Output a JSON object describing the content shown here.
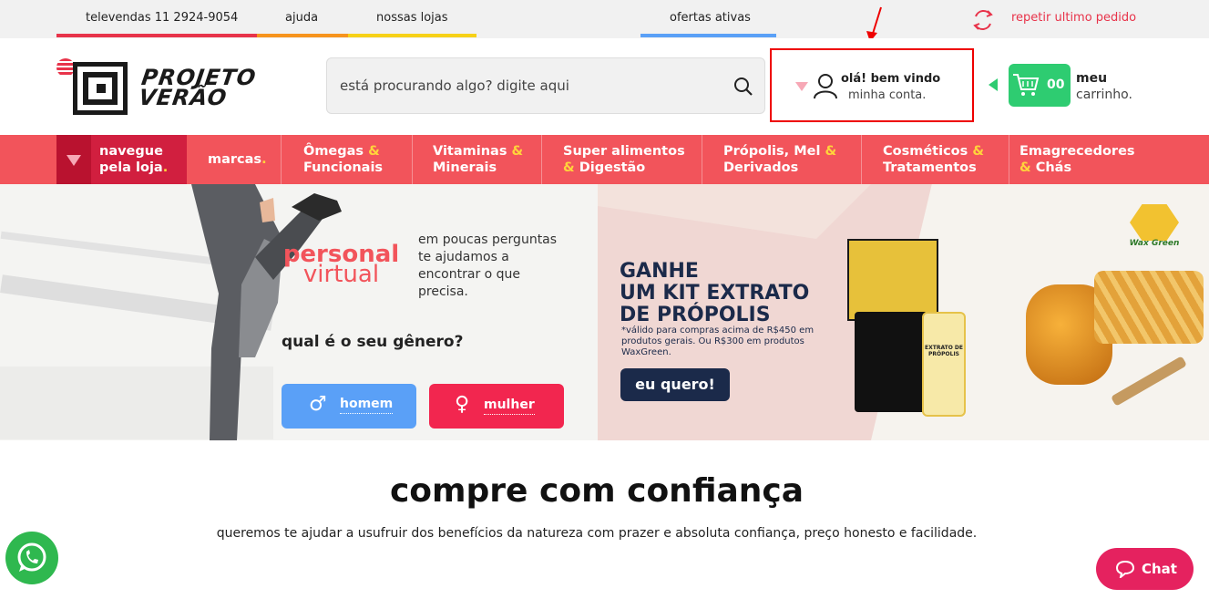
{
  "topbar": {
    "phone": "televendas 11 2924-9054",
    "help": "ajuda",
    "stores": "nossas lojas",
    "offers": "ofertas ativas",
    "repeat_order": "repetir ultimo pedido"
  },
  "logo": {
    "line1": "PROJETO",
    "line2": "VERÃO"
  },
  "search": {
    "placeholder": "está procurando algo? digite aqui"
  },
  "account": {
    "greeting": "olá! bem vindo",
    "link": "minha conta."
  },
  "cart": {
    "count": "00",
    "label1": "meu",
    "label2": "carrinho."
  },
  "nav": {
    "browse1": "navegue",
    "browse2": "pela loja",
    "brands": "marcas",
    "items": [
      {
        "a": "Ômegas",
        "b": "Funcionais"
      },
      {
        "a": "Vitaminas",
        "b": "Minerais"
      },
      {
        "a": "Super alimentos",
        "b": "Digestão"
      },
      {
        "a": "Própolis, Mel",
        "b": "Derivados"
      },
      {
        "a": "Cosméticos",
        "b": "Tratamentos"
      },
      {
        "a": "Emagrecedores",
        "b": "Chás"
      }
    ]
  },
  "personal": {
    "title1": "personal",
    "title2": "virtual",
    "desc": "em poucas perguntas te ajudamos a encontrar o que precisa.",
    "question": "qual é o seu gênero?",
    "male": "homem",
    "female": "mulher"
  },
  "promo": {
    "line1": "GANHE",
    "line2": "UM KIT EXTRATO",
    "line3": "DE PRÓPOLIS",
    "note": "*válido para compras acima de R$450 em produtos gerais. Ou R$300 em produtos WaxGreen.",
    "cta": "eu quero!",
    "brand": "Wax Green",
    "product_label": "EXTRATO DE PRÓPOLIS"
  },
  "trust": {
    "title": "compre com confiança",
    "subtitle": "queremos te ajudar a usufruir dos benefícios da natureza com prazer e absoluta confiança, preço honesto e facilidade."
  },
  "chat": {
    "label": "Chat"
  },
  "colors": {
    "accent": "#f2545b",
    "green": "#2ecc71",
    "pink": "#e5225f",
    "blue": "#5aa0f7",
    "navy": "#1b2a4a"
  }
}
